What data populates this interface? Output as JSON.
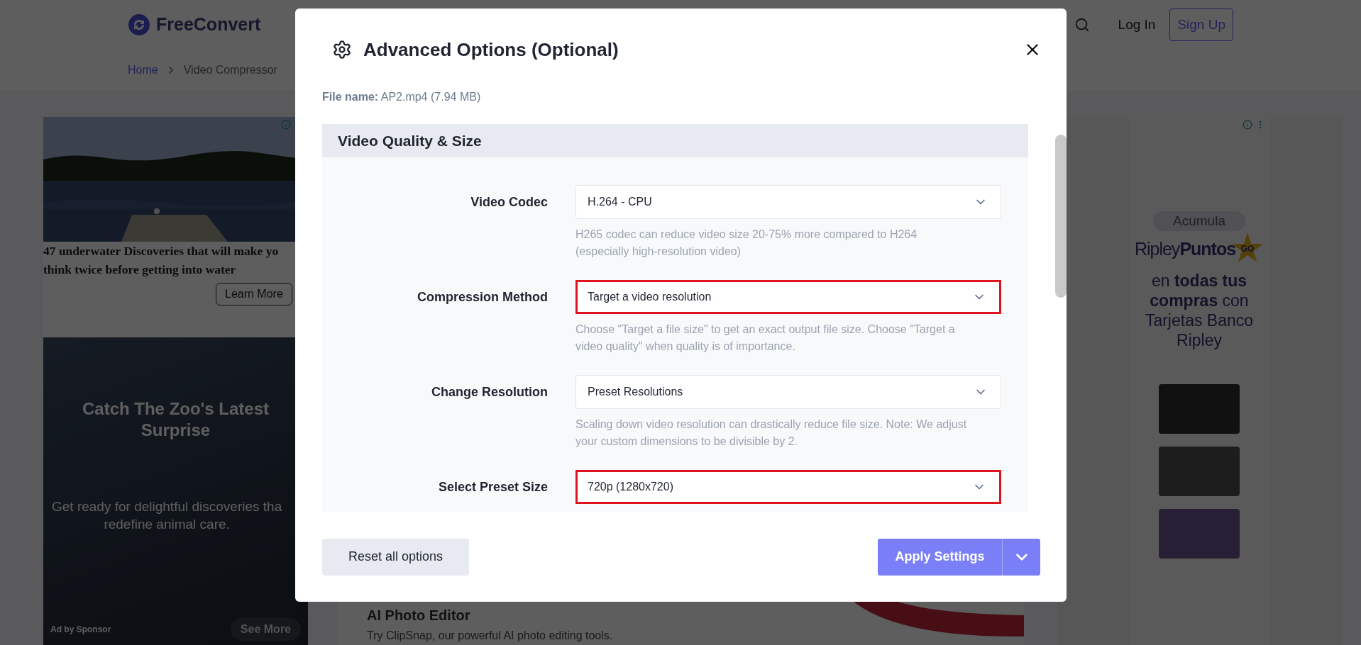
{
  "site_header": {
    "logo_text": "FreeConvert",
    "nav": [
      {
        "kind": "search"
      },
      {
        "kind": "link",
        "label": "Log In"
      },
      {
        "kind": "button",
        "label": "Sign Up"
      }
    ]
  },
  "breadcrumb": [
    "Home",
    "Video Compressor"
  ],
  "left_ad": {
    "headline_lines": [
      "47 underwater Discoveries that will make yo",
      "think twice before getting into water"
    ],
    "cta": "Learn More"
  },
  "left_ad_2": {
    "title": "Catch The Zoo's Latest Surprise",
    "body_lines": [
      "Get ready for delightful discoveries tha",
      "redefine animal care."
    ],
    "sponsor": "Ad by Sponsor",
    "cta": "See More"
  },
  "content_card": {
    "title": "AI Photo Editor",
    "text": "Try ClipSnap, our powerful AI photo editing tools."
  },
  "right_ad": {
    "pill": "Acumula",
    "brand": "Ripley**Puntos**",
    "badge": "GO",
    "text": "en **todas tus compras** con Tarjetas Banco Ripley"
  },
  "modal": {
    "title": "Advanced Options (Optional)",
    "file_name": "**File name:** AP2.mp4 (7.94 MB)",
    "section": "Video Quality & Size",
    "fields": [
      {
        "label": "Video Codec",
        "value": "H.264 - CPU",
        "highlighted": false,
        "hint": "H265 codec can reduce video size 20-75% more compared to H264 (especially high-resolution video)"
      },
      {
        "label": "Compression Method",
        "value": "Target a video resolution",
        "highlighted": true,
        "hint": "Choose \"Target a file size\" to get an exact output file size. Choose \"Target a video quality\" when quality is of importance."
      },
      {
        "label": "Change Resolution",
        "value": "Preset Resolutions",
        "highlighted": false,
        "hint": "Scaling down video resolution can drastically reduce file size. Note: We adjust your custom dimensions to be divisible by 2."
      },
      {
        "label": "Select Preset Size",
        "value": "720p (1280x720)",
        "highlighted": true
      }
    ],
    "buttons": [
      {
        "kind": "secondary",
        "label": "Reset all options"
      },
      {
        "kind": "primary",
        "label": "Apply Settings"
      }
    ]
  }
}
